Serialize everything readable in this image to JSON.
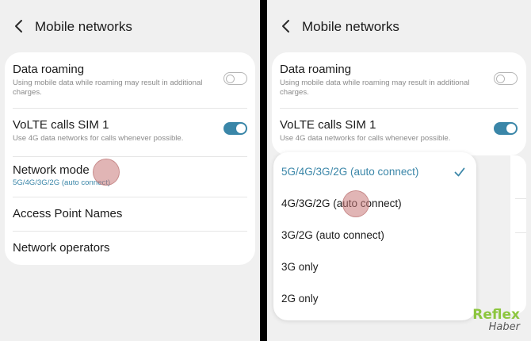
{
  "header": {
    "title": "Mobile networks"
  },
  "settings": {
    "data_roaming": {
      "title": "Data roaming",
      "subtitle": "Using mobile data while roaming may result in additional charges.",
      "enabled": false
    },
    "volte": {
      "title": "VoLTE calls SIM 1",
      "subtitle": "Use 4G data networks for calls whenever possible.",
      "enabled": true
    },
    "network_mode": {
      "title": "Network mode",
      "value": "5G/4G/3G/2G (auto connect)"
    },
    "apn": {
      "title": "Access Point Names"
    },
    "operators": {
      "title": "Network operators"
    }
  },
  "network_mode_popup": {
    "options": [
      "5G/4G/3G/2G (auto connect)",
      "4G/3G/2G (auto connect)",
      "3G/2G (auto connect)",
      "3G only",
      "2G only"
    ],
    "selected_index": 0
  },
  "watermark": {
    "brand": "Reflex",
    "sub": "Haber"
  },
  "colors": {
    "accent": "#3a86a8",
    "background": "#f0f0f0",
    "card": "#ffffff",
    "watermark": "#8cc63f"
  },
  "icons": {
    "back": "chevron-left-icon",
    "selected": "check-icon"
  }
}
